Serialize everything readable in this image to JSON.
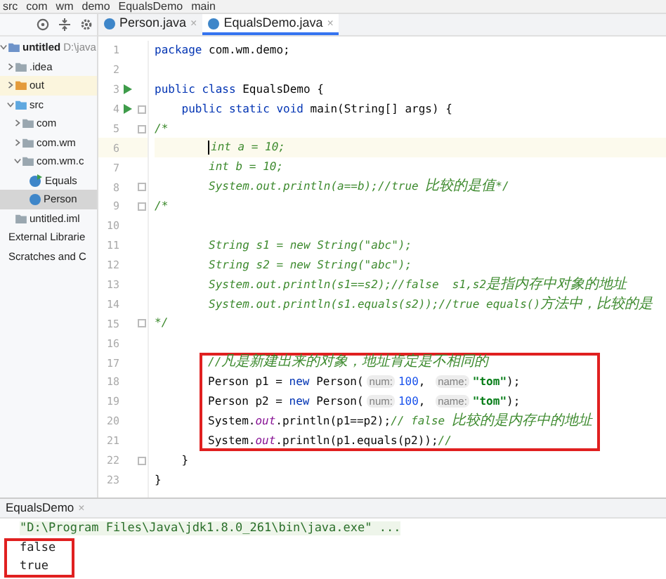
{
  "breadcrumb": [
    "src",
    "com",
    "wm",
    "demo",
    "EqualsDemo",
    "main"
  ],
  "tabs": [
    {
      "label": "Person.java",
      "close": "×",
      "selected": false
    },
    {
      "label": "EqualsDemo.java",
      "close": "×",
      "selected": true
    }
  ],
  "project_tree": [
    {
      "label": "untitled",
      "path": "D:\\java",
      "expanded": true,
      "kind": "module",
      "selected": false,
      "children": [
        {
          "label": ".idea",
          "kind": "folder",
          "expanded": false,
          "selected": false
        },
        {
          "label": "out",
          "kind": "output",
          "expanded": false,
          "selected": false
        },
        {
          "label": "src",
          "kind": "source",
          "expanded": true,
          "selected": false,
          "children": [
            {
              "label": "com",
              "kind": "package",
              "expanded": false,
              "selected": false
            },
            {
              "label": "com.wm",
              "kind": "package",
              "expanded": false,
              "selected": false
            },
            {
              "label": "com.wm.c",
              "kind": "package",
              "expanded": true,
              "selected": false,
              "children": [
                {
                  "label": "Equals",
                  "kind": "runclass",
                  "selected": false
                },
                {
                  "label": "Person",
                  "kind": "class",
                  "selected": true
                }
              ]
            }
          ]
        },
        {
          "label": "untitled.iml",
          "kind": "file",
          "selected": false
        }
      ]
    },
    {
      "label": "External Librarie",
      "kind": "plain",
      "selected": false
    },
    {
      "label": "Scratches and C",
      "kind": "plain",
      "selected": false
    }
  ],
  "editor_lines": [
    {
      "n": "1",
      "run": false,
      "fold": false,
      "current": false,
      "segs": [
        {
          "kind": "keyword",
          "text": "package"
        },
        {
          "kind": "plain",
          "text": " com.wm.demo;"
        }
      ]
    },
    {
      "n": "2",
      "run": false,
      "fold": false,
      "current": false
    },
    {
      "n": "3",
      "run": true,
      "fold": false,
      "current": false,
      "segs": [
        {
          "kind": "keyword",
          "text": "public class"
        },
        {
          "kind": "plain",
          "text": " EqualsDemo {"
        }
      ]
    },
    {
      "n": "4",
      "run": true,
      "fold": true,
      "current": false,
      "segs": [
        {
          "kind": "keyword",
          "text": "    public static void"
        },
        {
          "kind": "plain",
          "text": " main(String[] args) {"
        }
      ]
    },
    {
      "n": "5",
      "run": false,
      "fold": true,
      "current": false,
      "segs": [
        {
          "kind": "comment",
          "text": "/*"
        }
      ]
    },
    {
      "n": "6",
      "run": false,
      "fold": false,
      "current": true,
      "segs": [
        {
          "kind": "comment",
          "text": "int a = 10;"
        }
      ]
    },
    {
      "n": "7",
      "run": false,
      "fold": false,
      "current": false,
      "segs": [
        {
          "kind": "comment",
          "text": "        int b = 10;"
        }
      ]
    },
    {
      "n": "8",
      "run": false,
      "fold": true,
      "current": false,
      "segs": [
        {
          "kind": "comment",
          "text": "        System.out.println(a==b);//true "
        },
        {
          "kind": "comment_cjk",
          "text": "比较的是值"
        },
        {
          "kind": "comment",
          "text": "*/"
        }
      ]
    },
    {
      "n": "9",
      "run": false,
      "fold": true,
      "current": false,
      "segs": [
        {
          "kind": "comment",
          "text": "/*"
        }
      ]
    },
    {
      "n": "10",
      "run": false,
      "fold": false,
      "current": false
    },
    {
      "n": "11",
      "run": false,
      "fold": false,
      "current": false,
      "segs": [
        {
          "kind": "comment",
          "text": "        String s1 = new String(\"abc\");"
        }
      ]
    },
    {
      "n": "12",
      "run": false,
      "fold": false,
      "current": false,
      "segs": [
        {
          "kind": "comment",
          "text": "        String s2 = new String(\"abc\");"
        }
      ]
    },
    {
      "n": "13",
      "run": false,
      "fold": false,
      "current": false,
      "segs": [
        {
          "kind": "comment",
          "text": "        System.out.println(s1==s2);//false  s1,s2"
        },
        {
          "kind": "comment_cjk",
          "text": "是指内存中对象的地址"
        }
      ]
    },
    {
      "n": "14",
      "run": false,
      "fold": false,
      "current": false,
      "segs": [
        {
          "kind": "comment",
          "text": "        System.out.println(s1.equals(s2));//true equals()"
        },
        {
          "kind": "comment_cjk",
          "text": "方法中，比较的是"
        }
      ]
    },
    {
      "n": "15",
      "run": false,
      "fold": true,
      "current": false,
      "segs": [
        {
          "kind": "comment",
          "text": "*/"
        }
      ]
    },
    {
      "n": "16",
      "run": false,
      "fold": false,
      "current": false
    },
    {
      "n": "17",
      "run": false,
      "fold": false,
      "current": false,
      "segs": [
        {
          "kind": "comment",
          "text": "//"
        },
        {
          "kind": "comment_cjk",
          "text": "凡是新建出来的对象，地址肯定是不相同的"
        }
      ]
    },
    {
      "n": "18",
      "run": false,
      "fold": false,
      "current": false,
      "segs": [
        {
          "kind": "plain",
          "text": "Person p1 = "
        },
        {
          "kind": "keyword",
          "text": "new"
        },
        {
          "kind": "plain",
          "text": " Person("
        },
        {
          "kind": "hint",
          "text": "num:"
        },
        {
          "kind": "number",
          "text": "100"
        },
        {
          "kind": "plain",
          "text": ", "
        },
        {
          "kind": "hint",
          "text": "name:"
        },
        {
          "kind": "string",
          "text": "\"tom\""
        },
        {
          "kind": "plain",
          "text": ");"
        }
      ]
    },
    {
      "n": "19",
      "run": false,
      "fold": false,
      "current": false,
      "segs": [
        {
          "kind": "plain",
          "text": "Person p2 = "
        },
        {
          "kind": "keyword",
          "text": "new"
        },
        {
          "kind": "plain",
          "text": " Person("
        },
        {
          "kind": "hint",
          "text": "num:"
        },
        {
          "kind": "number",
          "text": "100"
        },
        {
          "kind": "plain",
          "text": ", "
        },
        {
          "kind": "hint",
          "text": "name:"
        },
        {
          "kind": "string",
          "text": "\"tom\""
        },
        {
          "kind": "plain",
          "text": ");"
        }
      ]
    },
    {
      "n": "20",
      "run": false,
      "fold": false,
      "current": false,
      "segs": [
        {
          "kind": "plain",
          "text": "System."
        },
        {
          "kind": "field",
          "text": "out"
        },
        {
          "kind": "plain",
          "text": ".println(p1==p2);"
        },
        {
          "kind": "comment",
          "text": "// false "
        },
        {
          "kind": "comment_cjk",
          "text": "比较的是内存中的地址"
        }
      ]
    },
    {
      "n": "21",
      "run": false,
      "fold": false,
      "current": false,
      "segs": [
        {
          "kind": "plain",
          "text": "System."
        },
        {
          "kind": "field",
          "text": "out"
        },
        {
          "kind": "plain",
          "text": ".println(p1.equals(p2));"
        },
        {
          "kind": "comment",
          "text": "//"
        }
      ]
    },
    {
      "n": "22",
      "run": false,
      "fold": true,
      "current": false,
      "segs": [
        {
          "kind": "plain",
          "text": "    }"
        }
      ]
    },
    {
      "n": "23",
      "run": false,
      "fold": false,
      "current": false,
      "segs": [
        {
          "kind": "plain",
          "text": "}"
        }
      ]
    }
  ],
  "run_panel": {
    "tab": "EqualsDemo",
    "close": "×",
    "command": "\"D:\\Program Files\\Java\\jdk1.8.0_261\\bin\\java.exe\" ...",
    "output": [
      "false",
      "true"
    ]
  }
}
